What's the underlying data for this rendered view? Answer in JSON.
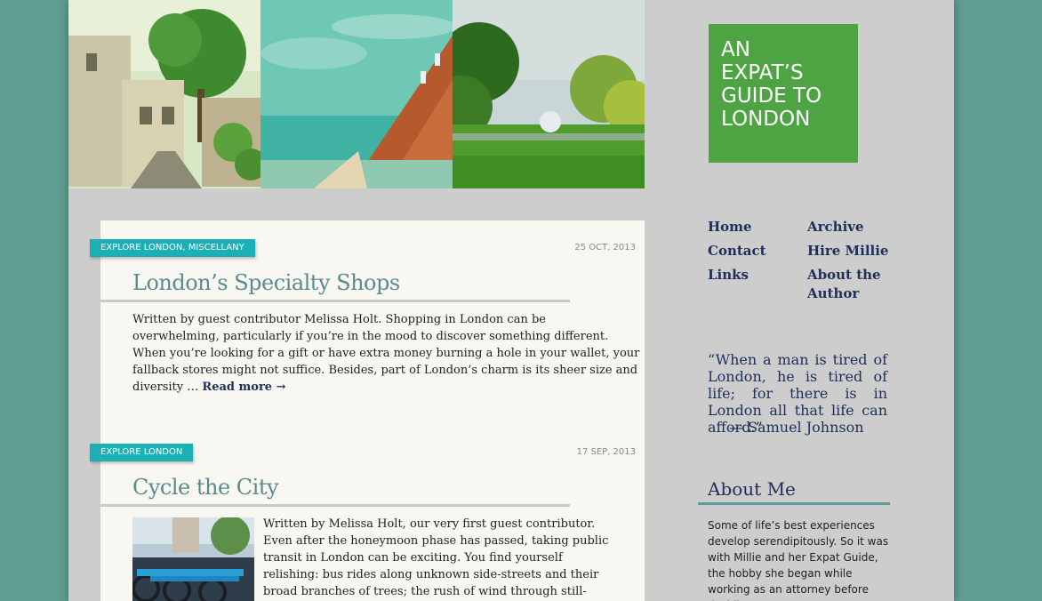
{
  "site": {
    "logo_lines": [
      "AN",
      "EXPAT’S",
      "GUIDE TO",
      "LONDON"
    ]
  },
  "nav": {
    "items": [
      "Home",
      "Archive",
      "Contact",
      "Hire Millie",
      "Links",
      "About the",
      "Author"
    ]
  },
  "quote": {
    "text": "“When a man is tired of London, he is tired of life; for there is in London all that life can afford.”",
    "author": "— Samuel Johnson"
  },
  "about": {
    "title": "About Me",
    "text": "Some of life’s best experiences develop serendipitously. So it was with Millie and her Expat Guide, the hobby she began while working as an attorney before deciding to pursue"
  },
  "posts": [
    {
      "tags": "EXPLORE LONDON, MISCELLANY",
      "date": "25 OCT, 2013",
      "title": "London’s Specialty Shops",
      "lines": [
        "Written by guest contributor Melissa Holt. Shopping in London can be",
        "overwhelming, particularly if you’re in the mood to discover something different.",
        "When you’re looking for a gift or have extra money burning a hole in your wallet, your",
        "fallback stores might not suffice. Besides, part of London’s charm is its sheer size and",
        "diversity …"
      ],
      "read_more": "Read more →"
    },
    {
      "tags": "EXPLORE LONDON",
      "date": "17 SEP, 2013",
      "title": "Cycle the City",
      "lines": [
        "Written by Melissa Holt, our very first guest contributor.",
        "Even after the honeymoon phase has passed, taking public",
        "transit in London can be exciting. You find yourself",
        "relishing: bus rides along unknown side-streets and their",
        "broad branches of trees; the rush of wind through still-"
      ]
    }
  ]
}
